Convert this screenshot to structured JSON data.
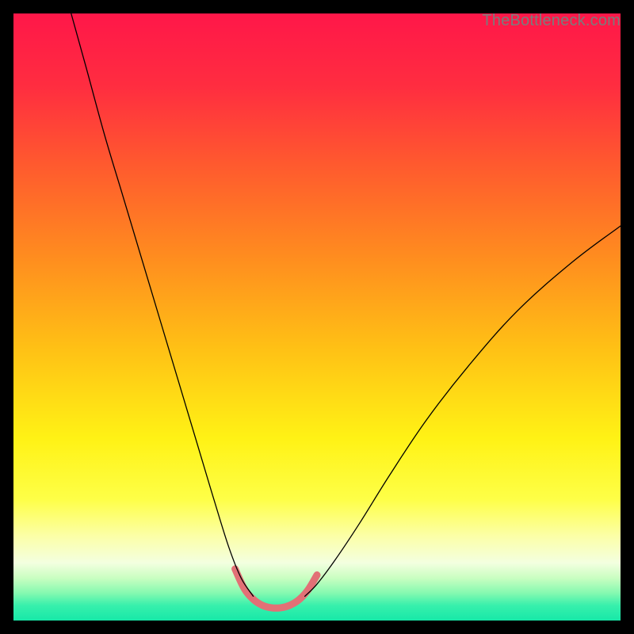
{
  "watermark": "TheBottleneck.com",
  "chart_data": {
    "type": "line",
    "title": "",
    "xlabel": "",
    "ylabel": "",
    "xlim": [
      0,
      100
    ],
    "ylim": [
      0,
      100
    ],
    "gradient_stops": [
      {
        "pos": 0.0,
        "color": "#ff1749"
      },
      {
        "pos": 0.12,
        "color": "#ff2d40"
      },
      {
        "pos": 0.25,
        "color": "#ff5a2e"
      },
      {
        "pos": 0.4,
        "color": "#ff8c1f"
      },
      {
        "pos": 0.55,
        "color": "#ffc015"
      },
      {
        "pos": 0.7,
        "color": "#fff215"
      },
      {
        "pos": 0.8,
        "color": "#feff47"
      },
      {
        "pos": 0.86,
        "color": "#fcffa6"
      },
      {
        "pos": 0.905,
        "color": "#f3ffe0"
      },
      {
        "pos": 0.93,
        "color": "#c9fec1"
      },
      {
        "pos": 0.955,
        "color": "#84f9b0"
      },
      {
        "pos": 0.975,
        "color": "#38f0ac"
      },
      {
        "pos": 1.0,
        "color": "#17e8a8"
      }
    ],
    "series": [
      {
        "name": "left-branch",
        "color": "#000000",
        "width": 1.3,
        "x": [
          9.5,
          12,
          15,
          18,
          21,
          24,
          27,
          30,
          33,
          35.5,
          37.5,
          39.5
        ],
        "y": [
          100,
          91,
          80,
          70,
          60,
          50,
          40,
          30,
          20,
          12,
          7,
          4
        ]
      },
      {
        "name": "right-branch",
        "color": "#000000",
        "width": 1.3,
        "x": [
          48,
          50,
          53,
          57,
          62,
          68,
          75,
          83,
          92,
          100
        ],
        "y": [
          4,
          6,
          10,
          16,
          24,
          33,
          42,
          51,
          59,
          65
        ]
      },
      {
        "name": "bottom-highlight",
        "color": "#e27076",
        "width": 9,
        "x": [
          36.5,
          38,
          39.5,
          41,
          42.5,
          44,
          45.5,
          47,
          48.5,
          50
        ],
        "y": [
          8.5,
          5.3,
          3.5,
          2.5,
          2.1,
          2.1,
          2.5,
          3.4,
          5.0,
          7.5
        ]
      }
    ],
    "annotations": []
  }
}
